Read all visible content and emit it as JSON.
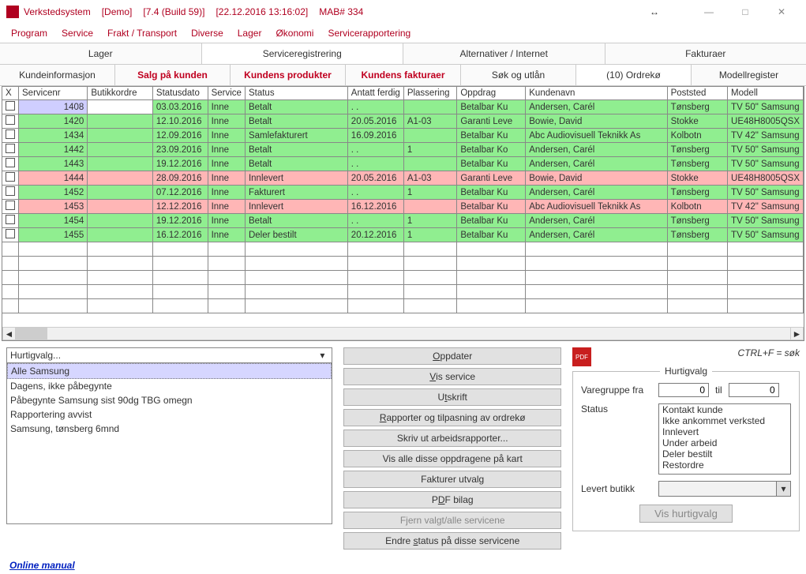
{
  "title": {
    "app": "Verkstedsystem",
    "mode": "[Demo]",
    "build": "[7.4 (Build 59)]",
    "ts": "[22.12.2016   13:16:02]",
    "mab": "MAB# 334"
  },
  "menu": [
    "Program",
    "Service",
    "Frakt / Transport",
    "Diverse",
    "Lager",
    "Økonomi",
    "Servicerapportering"
  ],
  "topTabs": [
    "Lager",
    "Serviceregistrering",
    "Alternativer / Internet",
    "Fakturaer"
  ],
  "subTabs": [
    {
      "label": "Kundeinformasjon",
      "red": false
    },
    {
      "label": "Salg på kunden",
      "red": true
    },
    {
      "label": "Kundens produkter",
      "red": true
    },
    {
      "label": "Kundens fakturaer",
      "red": true
    },
    {
      "label": "Søk og utlån",
      "red": false
    },
    {
      "label": "(10) Ordrekø",
      "red": false,
      "active": true
    },
    {
      "label": "Modellregister",
      "red": false
    }
  ],
  "grid": {
    "headers": [
      "X",
      "Servicenr",
      "Butikkordre",
      "Statusdato",
      "Service",
      "Status",
      "Antatt ferdig",
      "Plassering",
      "Oppdrag",
      "Kundenavn",
      "Poststed",
      "Modell"
    ],
    "rows": [
      {
        "c": [
          "",
          "1408",
          "",
          "03.03.2016",
          "Inne",
          "Betalt",
          ". .",
          "",
          "Betalbar       Ku",
          "Andersen, Carél",
          "Tønsberg",
          "TV 50\" Samsung"
        ],
        "cls": [
          "",
          "g-lav",
          "",
          "g-green",
          "g-green",
          "g-green",
          "g-green",
          "g-green",
          "g-green",
          "g-green",
          "g-green",
          "g-green"
        ]
      },
      {
        "c": [
          "",
          "1420",
          "",
          "12.10.2016",
          "Inne",
          "Betalt",
          "20.05.2016",
          "A1-03",
          "Garanti    Leve",
          "Bowie, David",
          "Stokke",
          "UE48H8005QSX"
        ],
        "bg": "g-green"
      },
      {
        "c": [
          "",
          "1434",
          "",
          "12.09.2016",
          "Inne",
          "Samlefakturert",
          "16.09.2016",
          "",
          "Betalbar       Ku",
          "Abc Audiovisuell Teknikk As",
          "Kolbotn",
          "TV 42\" Samsung"
        ],
        "bg": "g-green"
      },
      {
        "c": [
          "",
          "1442",
          "",
          "23.09.2016",
          "Inne",
          "Betalt",
          ". .",
          "1",
          "Betalbar       Ko",
          "Andersen, Carél",
          "Tønsberg",
          "TV 50\" Samsung"
        ],
        "bg": "g-green"
      },
      {
        "c": [
          "",
          "1443",
          "",
          "19.12.2016",
          "Inne",
          "Betalt",
          ". .",
          "",
          "Betalbar       Ku",
          "Andersen, Carél",
          "Tønsberg",
          "TV 50\" Samsung"
        ],
        "bg": "g-green"
      },
      {
        "c": [
          "",
          "1444",
          "",
          "28.09.2016",
          "Inne",
          "Innlevert",
          "20.05.2016",
          "A1-03",
          "Garanti    Leve",
          "Bowie, David",
          "Stokke",
          "UE48H8005QSX"
        ],
        "bg": "g-pink"
      },
      {
        "c": [
          "",
          "1452",
          "",
          "07.12.2016",
          "Inne",
          "Fakturert",
          ". .",
          "1",
          "Betalbar       Ku",
          "Andersen, Carél",
          "Tønsberg",
          "TV 50\" Samsung"
        ],
        "bg": "g-green"
      },
      {
        "c": [
          "",
          "1453",
          "",
          "12.12.2016",
          "Inne",
          "Innlevert",
          "16.12.2016",
          "",
          "Betalbar       Ku",
          "Abc Audiovisuell Teknikk As",
          "Kolbotn",
          "TV 42\" Samsung"
        ],
        "bg": "g-pink"
      },
      {
        "c": [
          "",
          "1454",
          "",
          "19.12.2016",
          "Inne",
          "Betalt",
          ". .",
          "1",
          "Betalbar       Ku",
          "Andersen, Carél",
          "Tønsberg",
          "TV 50\" Samsung"
        ],
        "bg": "g-green"
      },
      {
        "c": [
          "",
          "1455",
          "",
          "16.12.2016",
          "Inne",
          "Deler bestilt",
          "20.12.2016",
          "1",
          "Betalbar       Ku",
          "Andersen, Carél",
          "Tønsberg",
          "TV 50\" Samsung"
        ],
        "bg": "g-green"
      }
    ]
  },
  "quickSelect": {
    "prompt": "Hurtigvalg...",
    "items": [
      "Alle Samsung",
      "Dagens, ikke påbegynte",
      "Påbegynte Samsung sist 90dg TBG omegn",
      "Rapportering avvist",
      "Samsung, tønsberg 6mnd"
    ],
    "selected": 0
  },
  "actions": [
    {
      "pre": "",
      "u": "O",
      "post": "ppdater"
    },
    {
      "pre": "",
      "u": "V",
      "post": "is service"
    },
    {
      "pre": "U",
      "u": "t",
      "post": "skrift"
    },
    {
      "pre": "",
      "u": "R",
      "post": "apporter og tilpasning av ordrekø"
    },
    {
      "pre": "Skriv ut arbeidsrapporter...",
      "u": "",
      "post": ""
    },
    {
      "pre": "Vis alle disse oppdragene på kart",
      "u": "",
      "post": ""
    },
    {
      "pre": "Fakturer utvalg",
      "u": "",
      "post": ""
    },
    {
      "pre": "P",
      "u": "D",
      "post": "F bilag"
    },
    {
      "pre": "Fjern valgt/alle servicene",
      "u": "",
      "post": "",
      "disabled": true
    },
    {
      "pre": "Endre ",
      "u": "s",
      "post": "tatus på disse servicene"
    }
  ],
  "right": {
    "ctrlf": "CTRL+F = søk",
    "hv_title": "Hurtigvalg",
    "vg_label": "Varegruppe fra",
    "vg_from": "0",
    "vg_til": "til",
    "vg_to": "0",
    "status_label": "Status",
    "status_opts": [
      "Kontakt kunde",
      "Ikke ankommet verksted",
      "Innlevert",
      "Under arbeid",
      "Deler bestilt",
      "Restordre"
    ],
    "levert_label": "Levert butikk",
    "vis_btn": "Vis hurtigvalg"
  },
  "online": "Online manual"
}
